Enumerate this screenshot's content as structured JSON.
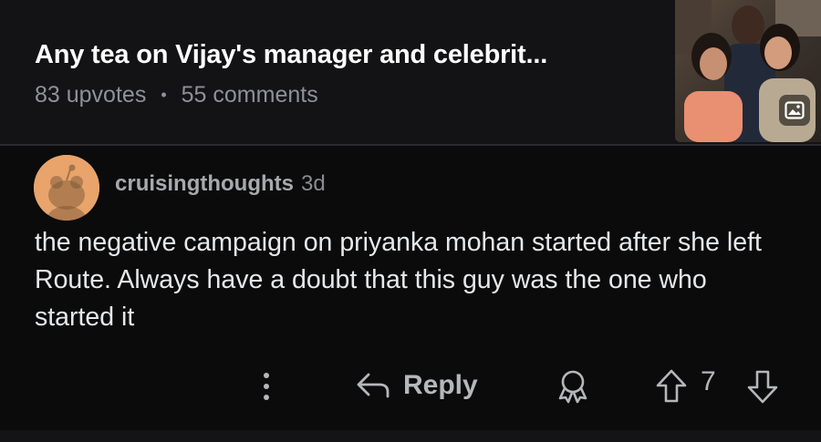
{
  "post": {
    "title": "Any tea on Vijay's manager and celebrit...",
    "upvotes": "83 upvotes",
    "separator": "•",
    "comments": "55 comments",
    "thumbnail_icon": "image-icon"
  },
  "comment": {
    "username": "cruisingthoughts",
    "age": "3d",
    "body": "the negative campaign on priyanka mohan started after she left Route. Always have a doubt that this guy was the one who started it",
    "avatar_color": "#e8a46a"
  },
  "actions": {
    "more_icon": "more-vertical-icon",
    "reply_label": "Reply",
    "reply_icon": "reply-arrow-icon",
    "award_icon": "award-icon",
    "upvote_icon": "upvote-arrow-icon",
    "vote_count": "7",
    "downvote_icon": "downvote-arrow-icon"
  }
}
